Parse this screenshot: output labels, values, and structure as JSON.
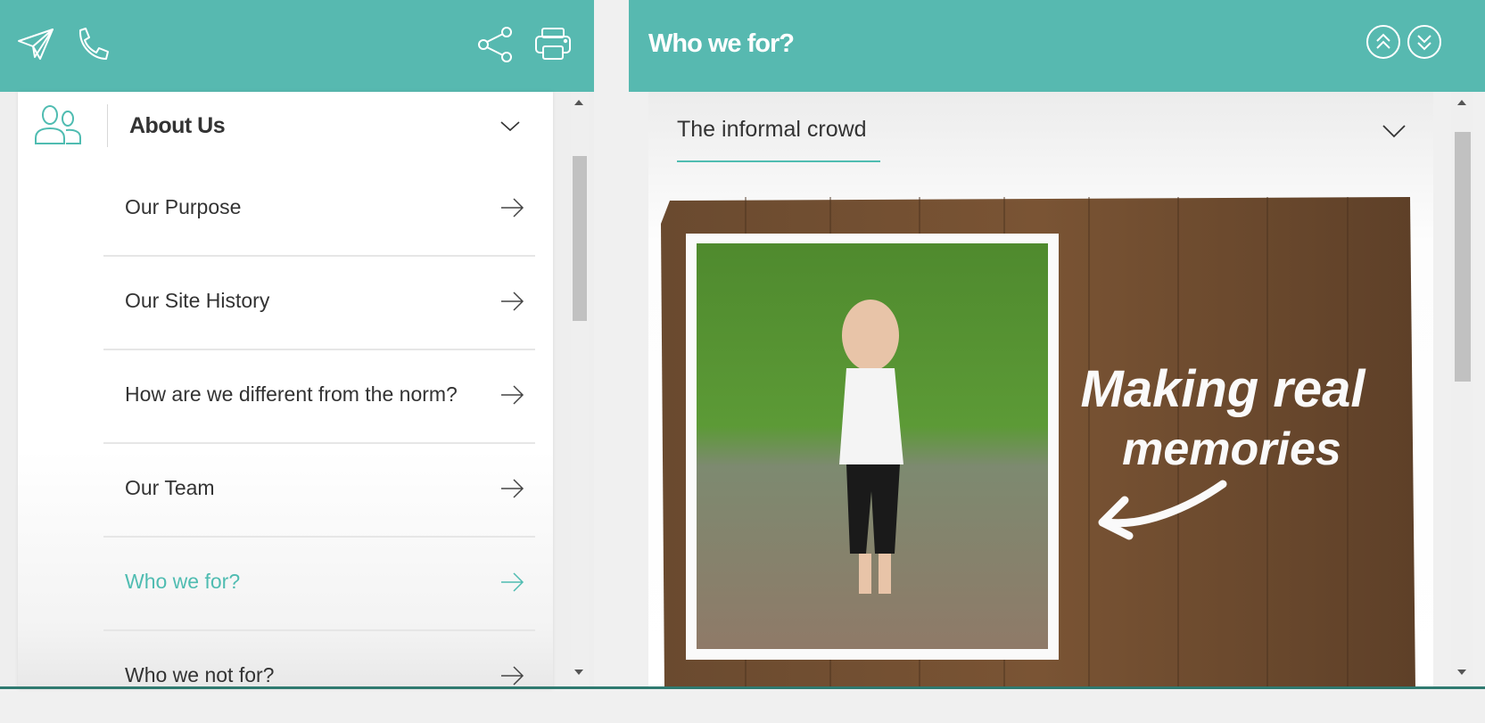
{
  "left_header": {
    "icons": [
      "send-icon",
      "phone-icon",
      "share-icon",
      "print-icon"
    ]
  },
  "sidebar": {
    "section_title": "About Us",
    "section_icon": "people-icon",
    "items": [
      {
        "label": "Our Purpose",
        "active": false
      },
      {
        "label": "Our Site History",
        "active": false
      },
      {
        "label": "How are we different from the norm?",
        "active": false
      },
      {
        "label": "Our Team",
        "active": false
      },
      {
        "label": "Who we for?",
        "active": true
      },
      {
        "label": "Who we not for?",
        "active": false
      }
    ]
  },
  "main": {
    "title": "Who we for?",
    "nav_buttons": [
      "scroll-up-double-icon",
      "scroll-down-double-icon"
    ],
    "dropdown": {
      "selected": "The informal crowd"
    },
    "hero_image": {
      "alt": "Toddler standing in a muddy puddle on grass, photo pinned to a wooden board",
      "caption": "Making real memories"
    }
  },
  "colors": {
    "accent": "#57b9b0",
    "active_text": "#4fbcb1",
    "text": "#333333",
    "wood": "#6b4a30"
  }
}
